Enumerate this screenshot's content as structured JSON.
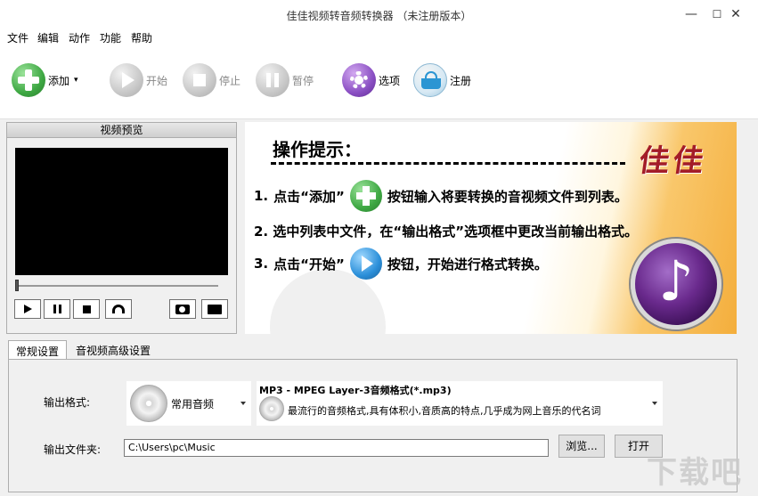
{
  "window": {
    "title": "佳佳视频转音频转换器 （未注册版本）",
    "minimize": "—",
    "maximize": "☐",
    "close": "✕"
  },
  "menu": [
    "文件",
    "编辑",
    "动作",
    "功能",
    "帮助"
  ],
  "toolbar": {
    "add": "添加",
    "add_arrow": "▾",
    "start": "开始",
    "stop": "停止",
    "pause": "暂停",
    "options": "选项",
    "register": "注册"
  },
  "preview": {
    "title": "视频预览"
  },
  "banner": {
    "title": "操作提示：",
    "brand": "佳佳",
    "step1": {
      "num": "1.",
      "before": "点击“添加”",
      "after": "按钮输入将要转换的音视频文件到列表。"
    },
    "step2": {
      "text": "2. 选中列表中文件，在“输出格式”选项框中更改当前输出格式。"
    },
    "step3": {
      "num": "3.",
      "before": "点击“开始”",
      "after": "按钮，开始进行格式转换。"
    },
    "music_note": "♪"
  },
  "tabs": [
    "常规设置",
    "音视频高级设置"
  ],
  "settings": {
    "output_format_label": "输出格式:",
    "category_value": "常用音频",
    "format_title": "MP3 - MPEG Layer-3音频格式(*.mp3)",
    "format_desc": "最流行的音频格式,具有体积小,音质高的特点,几乎成为网上音乐的代名词",
    "output_folder_label": "输出文件夹:",
    "output_folder_value": "C:\\Users\\pc\\Music",
    "browse": "浏览...",
    "open": "打开"
  },
  "watermark": "下载吧",
  "colors": {
    "add": "#4caf50",
    "play": "#2b8fd9",
    "options": "#7b3fb3",
    "register": "#3aa3d4",
    "disabled": "#bfbfbf"
  }
}
